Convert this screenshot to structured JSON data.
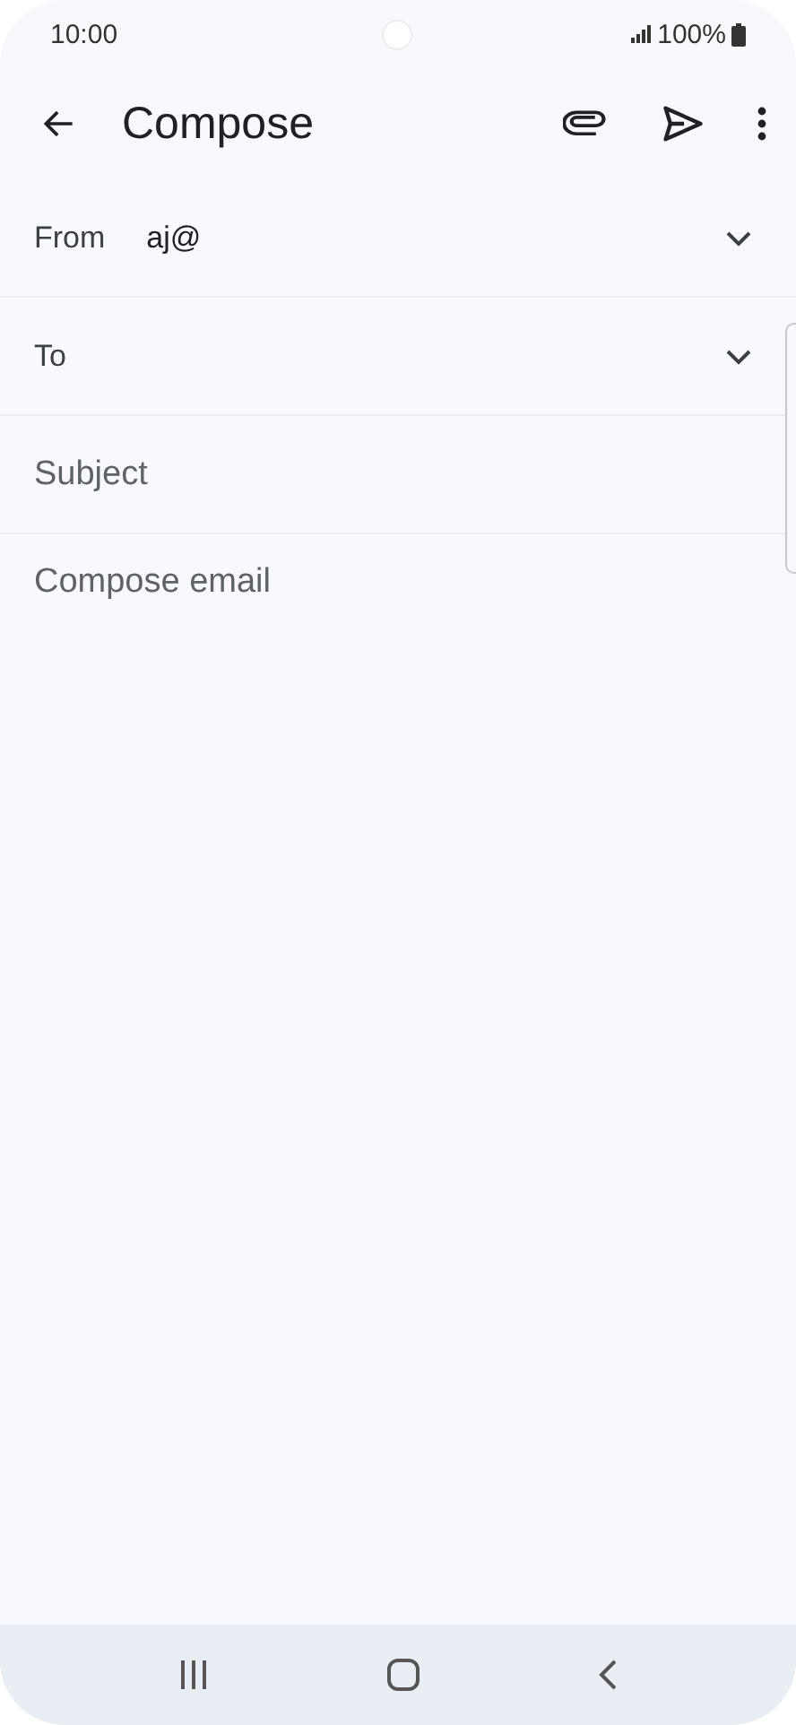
{
  "status_bar": {
    "time": "10:00",
    "battery": "100%"
  },
  "app_bar": {
    "title": "Compose"
  },
  "from": {
    "label": "From",
    "value": "aj@"
  },
  "to": {
    "label": "To"
  },
  "subject": {
    "placeholder": "Subject"
  },
  "body": {
    "placeholder": "Compose email"
  }
}
